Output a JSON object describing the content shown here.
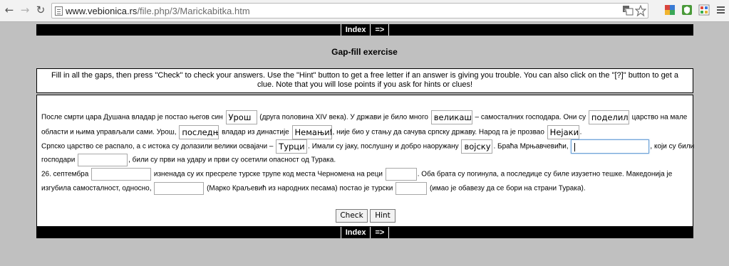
{
  "browser": {
    "url_host": "www.vebionica.rs",
    "url_path": "/file.php/3/Marickabitka.htm"
  },
  "navbar": {
    "index_label": "Index",
    "next_label": "=>"
  },
  "page": {
    "title": "Gap-fill exercise",
    "instructions": "Fill in all the gaps, then press \"Check\" to check your answers. Use the \"Hint\" button to get a free letter if an answer is giving you trouble. You can also click on the \"[?]\" button to get a clue. Note that you will lose points if you ask for hints or clues!"
  },
  "exercise": {
    "l1_t1": "После смрти цара Душана владар је постао његов син",
    "g1": "Урош",
    "l1_t2": "(друга половина XIV века). У држави је било много",
    "g2": "великаша",
    "l1_t3": "– самосталних господара. Они су",
    "g3": "поделили",
    "l1_t4": "царство на мале",
    "l2_t1": "области и њима управљали сами. Урош,",
    "g4": "последњи",
    "l2_t2": "владар из династије",
    "g5": "Немањић",
    "l2_t3": ", није био у стању да сачува српску државу. Народ га је прозвао",
    "g6": "Нејаки",
    "l2_t4": ".",
    "l3_t1": "Српско царство се распало, а с истока су долазили велики освајачи –",
    "g7": "Турци",
    "l3_t2": ". Имали су јаку, послушну и добро наоружану",
    "g8": "војску",
    "l3_t3": ". Браћа Мрњавчевићи,",
    "l3_t4": ", који су били",
    "l4_t1": "господари",
    "l4_t2": ", били су први на удару и први су осетили опасност од Турака.",
    "l5_t1": "26. септембра",
    "l5_t2": "изненада су их пресреле турске трупе код места Черномена на реци",
    "l5_t3": ". Оба брата су погинула, а последице су биле изузетно тешке. Македонија је",
    "l6_t1": "изгубила самосталност, односно,",
    "l6_t2": "(Марко Краљевић из народних песама) постао је турски",
    "l6_t3": "(имао је обавезу да се бори на страни Турака).",
    "check_label": "Check",
    "hint_label": "Hint"
  }
}
